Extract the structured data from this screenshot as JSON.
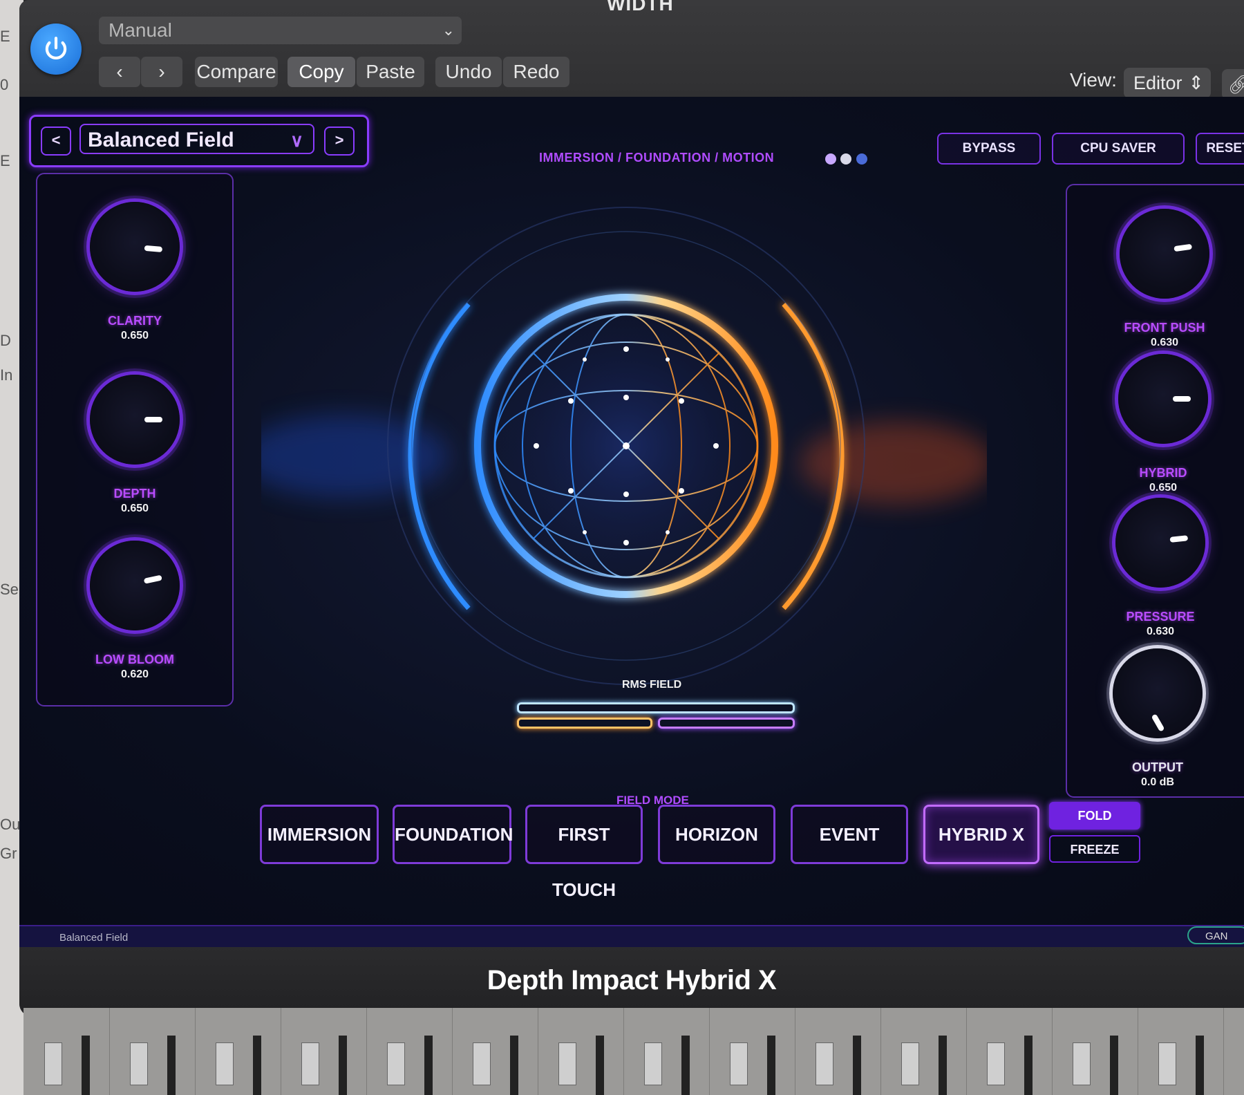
{
  "host": {
    "window_title": "WIDTH",
    "preset_menu": "Manual",
    "buttons": {
      "compare": "Compare",
      "copy": "Copy",
      "paste": "Paste",
      "undo": "Undo",
      "redo": "Redo"
    },
    "view_label": "View:",
    "view_value": "Editor"
  },
  "plugin": {
    "preset_name": "Balanced Field",
    "mode_path": "IMMERSION / FOUNDATION / MOTION",
    "top_buttons": {
      "bypass": "BYPASS",
      "cpu_saver": "CPU SAVER",
      "reset": "RESET"
    },
    "left_knobs": [
      {
        "label": "CLARITY",
        "value": "0.650"
      },
      {
        "label": "DEPTH",
        "value": "0.650"
      },
      {
        "label": "LOW BLOOM",
        "value": "0.620"
      }
    ],
    "right_knobs": [
      {
        "label": "FRONT PUSH",
        "value": "0.630"
      },
      {
        "label": "HYBRID",
        "value": "0.650"
      },
      {
        "label": "PRESSURE",
        "value": "0.630"
      },
      {
        "label": "OUTPUT",
        "value": "0.0 dB"
      }
    ],
    "rms_label": "RMS FIELD",
    "field_mode_label": "FIELD MODE",
    "field_modes": [
      "IMMERSION",
      "FOUNDATION",
      "FIRST TOUCH",
      "HORIZON",
      "EVENT",
      "HYBRID X"
    ],
    "active_field_mode": "HYBRID X",
    "fold": "FOLD",
    "freeze": "FREEZE",
    "status_preset": "Balanced Field",
    "gain_pill": "GAN",
    "plugin_title": "Depth Impact Hybrid X"
  },
  "colors": {
    "accent_purple": "#8a3cff",
    "power_blue": "#1a6fd8",
    "sphere_blue": "#2f8cff",
    "sphere_orange": "#ff9a2e"
  }
}
